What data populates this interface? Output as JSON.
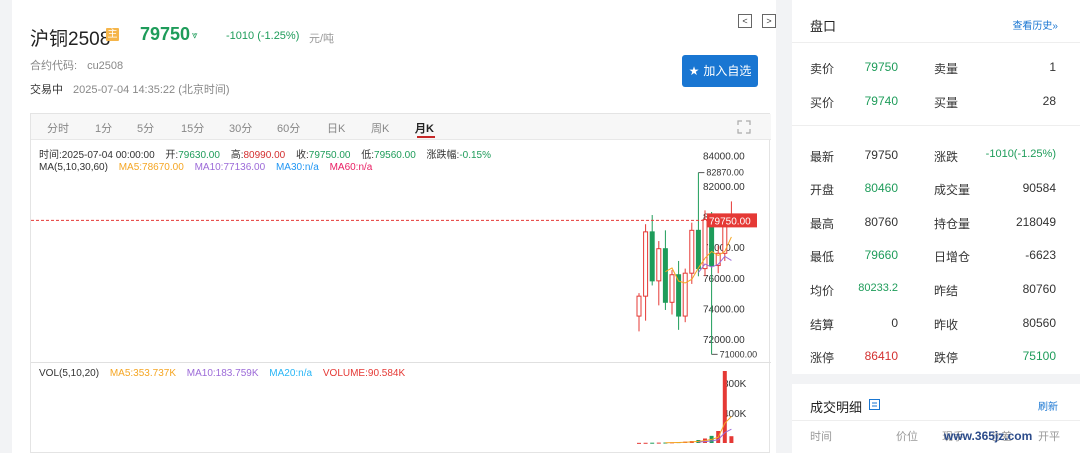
{
  "header": {
    "title": "沪铜2508",
    "badge": "主",
    "price": "79750",
    "arrow": "⩔",
    "change": "-1010 (-1.25%)",
    "unit": "元/吨",
    "contract_label": "合约代码:",
    "contract_code": "cu2508",
    "status": "交易中",
    "time": "2025-07-04 14:35:22 (北京时间)",
    "prev": "<",
    "next": ">",
    "add_button": "加入自选"
  },
  "tabs": [
    "分时",
    "1分",
    "5分",
    "15分",
    "30分",
    "60分",
    "日K",
    "周K",
    "月K"
  ],
  "active_tab": "月K",
  "info": {
    "time_label": "时间:",
    "time_value": "2025-07-04 00:00:00",
    "open_label": "开:",
    "open_value": "79630.00",
    "high_label": "高:",
    "high_value": "80990.00",
    "close_label": "收:",
    "close_value": "79750.00",
    "low_label": "低:",
    "low_value": "79560.00",
    "chg_label": "涨跌幅:",
    "chg_value": "-0.15%",
    "ma_label": "MA(5,10,30,60)",
    "ma5": "MA5:78670.00",
    "ma10": "MA10:77136.00",
    "ma30": "MA30:n/a",
    "ma60": "MA60:n/a",
    "vol_label": "VOL(5,10,20)",
    "vma5": "MA5:353.737K",
    "vma10": "MA10:183.759K",
    "vma20": "MA20:n/a",
    "volume": "VOLUME:90.584K"
  },
  "colors": {
    "up": "#e53935",
    "down": "#1e9c5a",
    "ma5": "#f5a623",
    "ma10": "#9c6ad8",
    "ma30": "#2196f3",
    "ma60": "#e91e63",
    "volma20": "#29b6f6",
    "volume": "#e53935"
  },
  "chart_data": {
    "type": "candlestick",
    "y_ticks": [
      "84000.00",
      "82000.00",
      "80000.00",
      "78000.00",
      "76000.00",
      "74000.00",
      "72000.00"
    ],
    "y_range": [
      70500,
      85000
    ],
    "current_price_label": "79750.00",
    "current_price": 79750,
    "high_marker": "82870.00",
    "high_marker_value": 82870,
    "low_marker": "71000.00",
    "low_marker_value": 71000,
    "candles": [
      {
        "o": 73500,
        "h": 75000,
        "l": 72500,
        "c": 74800
      },
      {
        "o": 74800,
        "h": 79500,
        "l": 73200,
        "c": 79000
      },
      {
        "o": 79000,
        "h": 80100,
        "l": 75500,
        "c": 75800
      },
      {
        "o": 75800,
        "h": 78400,
        "l": 74200,
        "c": 77900
      },
      {
        "o": 77900,
        "h": 79100,
        "l": 73900,
        "c": 74400
      },
      {
        "o": 74400,
        "h": 76500,
        "l": 73600,
        "c": 76200
      },
      {
        "o": 76200,
        "h": 77100,
        "l": 72600,
        "c": 73500
      },
      {
        "o": 73500,
        "h": 76600,
        "l": 73100,
        "c": 76300
      },
      {
        "o": 76300,
        "h": 79600,
        "l": 75600,
        "c": 79100
      },
      {
        "o": 79100,
        "h": 82870,
        "l": 76100,
        "c": 76600
      },
      {
        "o": 76600,
        "h": 80400,
        "l": 76100,
        "c": 79800
      },
      {
        "o": 79800,
        "h": 80300,
        "l": 71000,
        "c": 76800
      },
      {
        "o": 76800,
        "h": 78100,
        "l": 76300,
        "c": 77600
      },
      {
        "o": 77600,
        "h": 80100,
        "l": 77100,
        "c": 79600
      },
      {
        "o": 79600,
        "h": 80990,
        "l": 79560,
        "c": 79750
      }
    ],
    "ma5_values": [
      null,
      null,
      null,
      null,
      76400,
      76640,
      75780,
      75660,
      75900,
      76640,
      77280,
      77720,
      77460,
      77720,
      78670
    ],
    "ma10_values": [
      null,
      null,
      null,
      null,
      null,
      null,
      null,
      null,
      null,
      76340,
      76900,
      76700,
      76880,
      77400,
      77136
    ],
    "vol_ticks": [
      "800K",
      "400K"
    ],
    "vol_range": [
      0,
      1000
    ],
    "volumes": [
      2,
      3,
      4,
      5,
      6,
      9,
      12,
      18,
      26,
      40,
      60,
      95,
      160,
      960,
      90.584
    ],
    "vol_ma5_values": [
      null,
      null,
      null,
      null,
      4,
      5.4,
      7.2,
      10,
      14.2,
      21,
      31.2,
      47.8,
      76.2,
      263,
      353.737
    ],
    "vol_ma10_values": [
      null,
      null,
      null,
      null,
      null,
      null,
      null,
      null,
      null,
      12.5,
      18.3,
      27.5,
      43.1,
      138.5,
      183.759
    ]
  },
  "panel": {
    "title": "盘口",
    "history_link": "查看历史»",
    "sell_label": "卖价",
    "sell_value": "79750",
    "sell_qty_label": "卖量",
    "sell_qty_value": "1",
    "buy_label": "买价",
    "buy_value": "79740",
    "buy_qty_label": "买量",
    "buy_qty_value": "28",
    "rows": [
      {
        "l1": "最新",
        "v1": "79750",
        "c1": "dark",
        "l2": "涨跌",
        "v2": "-1010(-1.25%)",
        "c2": "green"
      },
      {
        "l1": "开盘",
        "v1": "80460",
        "c1": "green",
        "l2": "成交量",
        "v2": "90584",
        "c2": "dark"
      },
      {
        "l1": "最高",
        "v1": "80760",
        "c1": "dark",
        "l2": "持仓量",
        "v2": "218049",
        "c2": "dark"
      },
      {
        "l1": "最低",
        "v1": "79660",
        "c1": "green",
        "l2": "日增仓",
        "v2": "-6623",
        "c2": "dark"
      },
      {
        "l1": "均价",
        "v1": "80233.2",
        "c1": "green",
        "l2": "昨结",
        "v2": "80760",
        "c2": "dark"
      },
      {
        "l1": "结算",
        "v1": "0",
        "c1": "dark",
        "l2": "昨收",
        "v2": "80560",
        "c2": "dark"
      },
      {
        "l1": "涨停",
        "v1": "86410",
        "c1": "red",
        "l2": "跌停",
        "v2": "75100",
        "c2": "green"
      }
    ],
    "trades_title": "成交明细",
    "refresh": "刷新",
    "trade_headers": [
      "时间",
      "价位",
      "现手",
      "仓差",
      "开平"
    ]
  },
  "watermark": "www.365jz.com"
}
